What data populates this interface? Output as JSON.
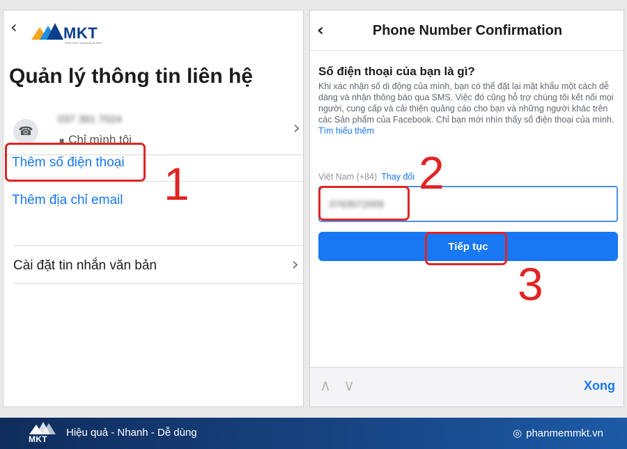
{
  "brand": {
    "logo_text": "MKT",
    "logo_tagline": "Phần mềm marketing đa kênh",
    "slogan": "Hiệu quả - Nhanh - Dễ dùng",
    "website": "phanmemmkt.vn",
    "colors": {
      "brand_navy": "#0b3e8c",
      "accent_blue": "#1877f2",
      "highlight_red": "#e02424"
    }
  },
  "left_screen": {
    "back_icon": "chevron-left-icon",
    "title": "Quản lý thông tin liên hệ",
    "phone_entry": {
      "number": "037 391 7024",
      "privacy_label": "Chỉ mình tôi",
      "privacy_icon": "lock-icon"
    },
    "add_phone_label": "Thêm số điện thoại",
    "add_email_label": "Thêm địa chỉ email",
    "sms_settings_label": "Cài đặt tin nhắn văn bản"
  },
  "right_screen": {
    "title": "Phone Number Confirmation",
    "question": "Số điện thoại của bạn là gì?",
    "description": "Khi xác nhận số di động của mình, bạn có thể đặt lại mật khẩu một cách dễ dàng và nhận thông báo qua SMS. Việc đó cũng hỗ trợ chúng tôi kết nối mọi người, cung cấp và cải thiện quảng cáo cho bạn và những người khác trên các Sản phẩm của Facebook. Chỉ bạn mới nhìn thấy số điện thoại của mình.",
    "learn_more": "Tìm hiểu thêm",
    "country": "Việt Nam (+84)",
    "change": "Thay đổi",
    "phone_value": "0763572009",
    "continue_label": "Tiếp tục",
    "keyboard_done": "Xong"
  },
  "annotations": {
    "step1": "1",
    "step2": "2",
    "step3": "3"
  }
}
